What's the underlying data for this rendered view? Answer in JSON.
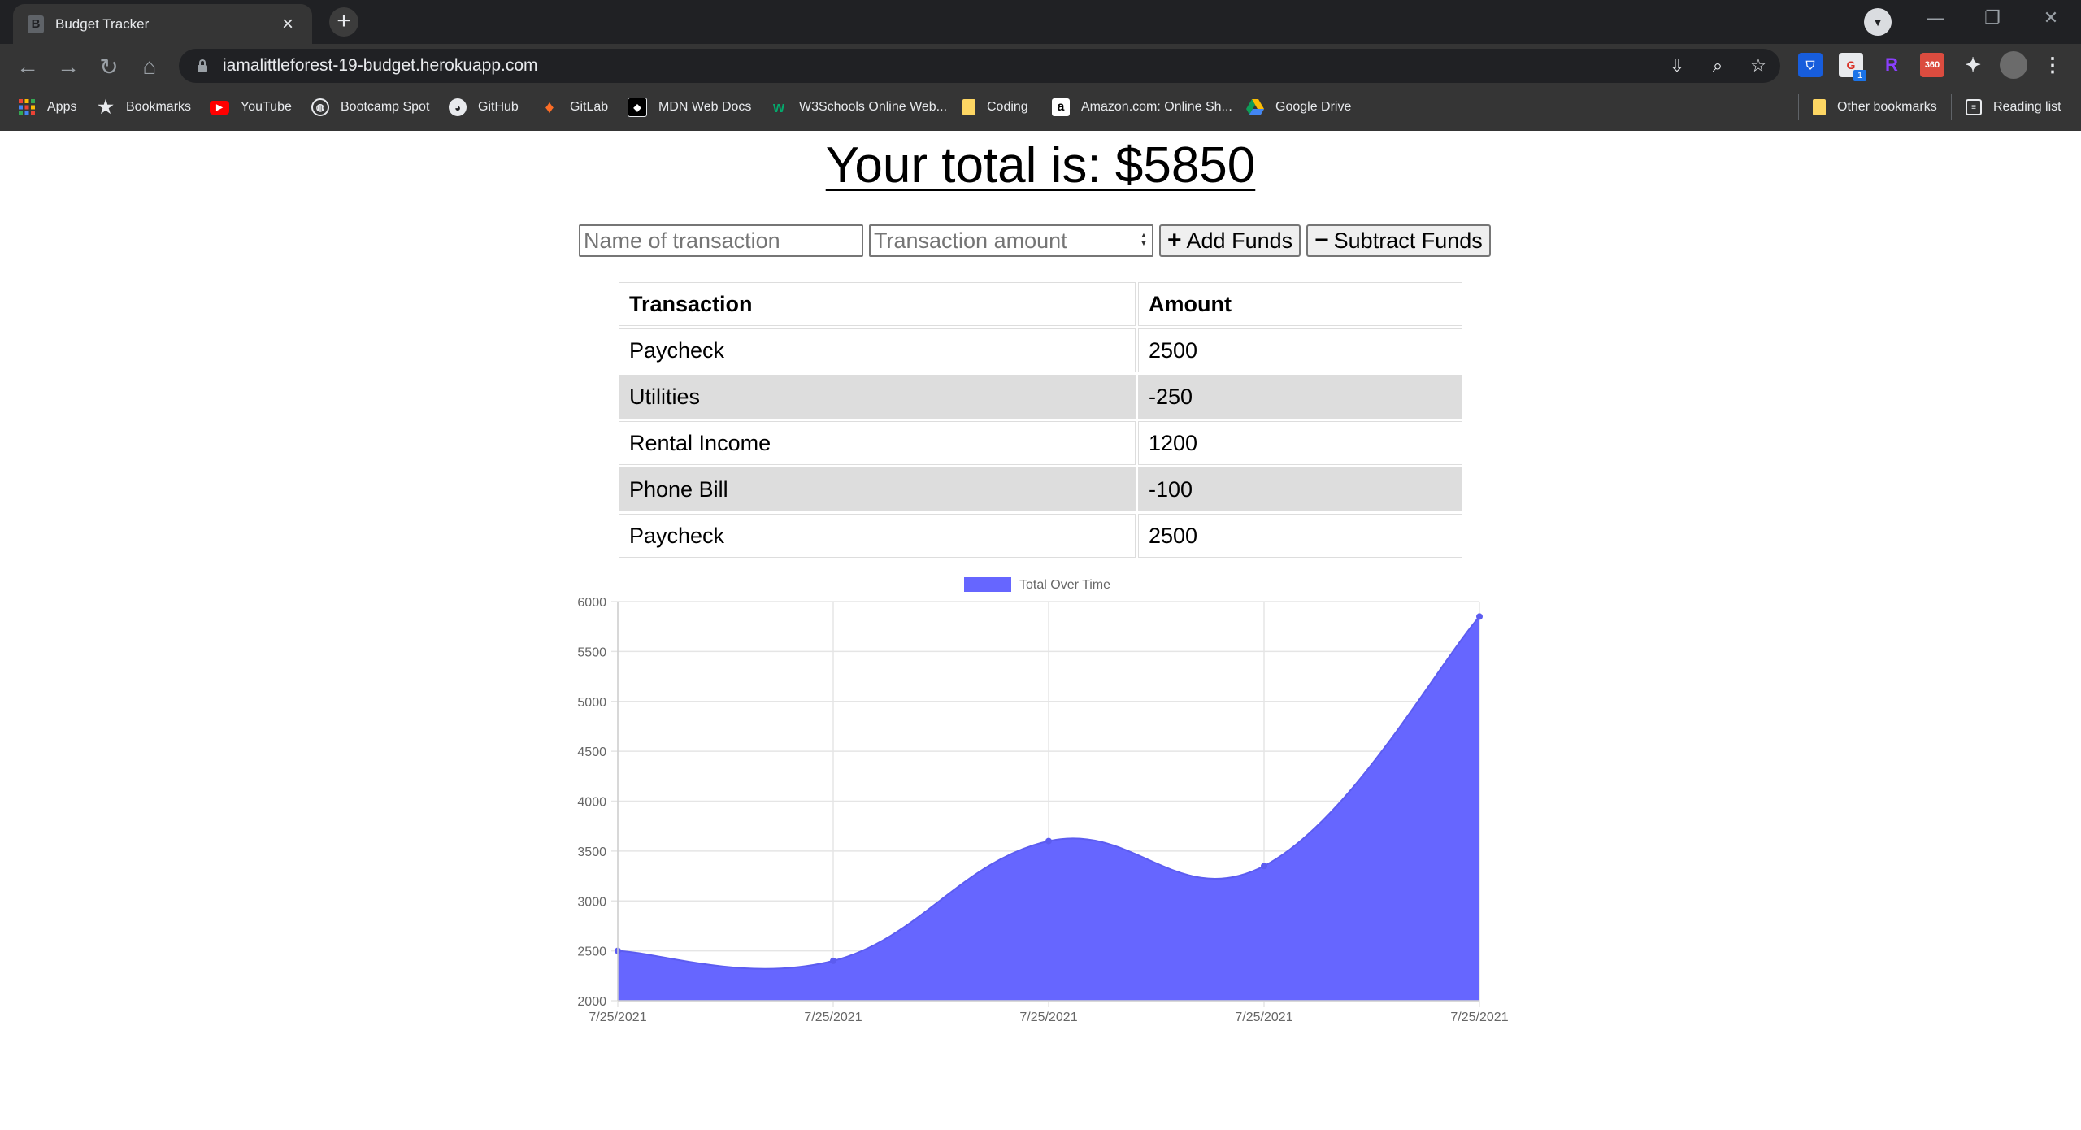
{
  "browser": {
    "tab_title": "Budget Tracker",
    "tab_favicon": "B",
    "url": "iamalittleforest-19-budget.herokuapp.com",
    "bookmarks": [
      {
        "label": "Apps",
        "icon": "apps-grid-icon"
      },
      {
        "label": "Bookmarks",
        "icon": "star-icon"
      },
      {
        "label": "YouTube",
        "icon": "youtube-icon"
      },
      {
        "label": "Bootcamp Spot",
        "icon": "globe-icon"
      },
      {
        "label": "GitHub",
        "icon": "github-icon"
      },
      {
        "label": "GitLab",
        "icon": "gitlab-icon"
      },
      {
        "label": "MDN Web Docs",
        "icon": "mdn-icon"
      },
      {
        "label": "W3Schools Online Web...",
        "icon": "w3schools-icon"
      },
      {
        "label": "Coding",
        "icon": "folder-icon"
      },
      {
        "label": "Amazon.com: Online Sh...",
        "icon": "amazon-icon"
      },
      {
        "label": "Google Drive",
        "icon": "google-drive-icon"
      }
    ],
    "bookmarks_right": [
      {
        "label": "Other bookmarks",
        "icon": "folder-icon"
      },
      {
        "label": "Reading list",
        "icon": "reading-list-icon"
      }
    ],
    "extension_badges": {
      "grammarly": "1",
      "todoist": "360"
    }
  },
  "page": {
    "total_label": "Your total is: $5850",
    "name_placeholder": "Name of transaction",
    "amount_placeholder": "Transaction amount",
    "add_button": "Add Funds",
    "subtract_button": "Subtract Funds",
    "add_icon": "+",
    "subtract_icon": "−"
  },
  "table": {
    "headers": [
      "Transaction",
      "Amount"
    ],
    "rows": [
      {
        "name": "Paycheck",
        "amount": "2500"
      },
      {
        "name": "Utilities",
        "amount": "-250"
      },
      {
        "name": "Rental Income",
        "amount": "1200"
      },
      {
        "name": "Phone Bill",
        "amount": "-100"
      },
      {
        "name": "Paycheck",
        "amount": "2500"
      }
    ]
  },
  "chart_data": {
    "type": "area",
    "legend": "top",
    "grid": true,
    "x": [
      "7/25/2021",
      "7/25/2021",
      "7/25/2021",
      "7/25/2021",
      "7/25/2021"
    ],
    "series": [
      {
        "name": "Total Over Time",
        "values": [
          2500,
          2400,
          3600,
          3350,
          5850
        ],
        "color": "#6666ff"
      }
    ],
    "ylim": [
      2000,
      6000
    ],
    "yticks": [
      2000,
      2500,
      3000,
      3500,
      4000,
      4500,
      5000,
      5500,
      6000
    ]
  }
}
